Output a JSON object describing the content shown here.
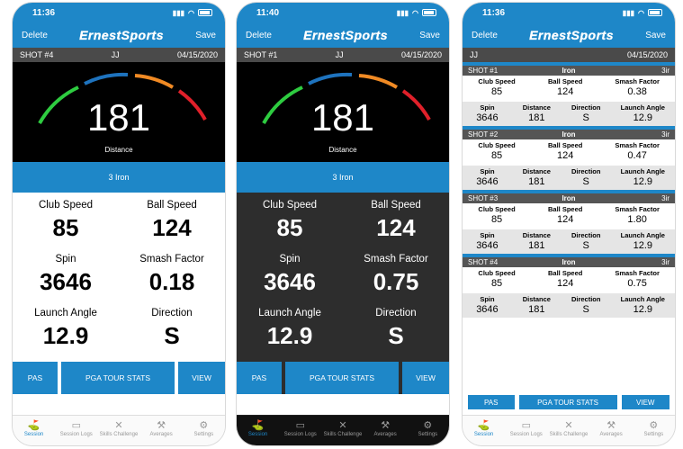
{
  "status": {
    "time1": "11:36",
    "time2": "11:40",
    "time3": "11:36"
  },
  "nav": {
    "left": "Delete",
    "brand": "ErnestSports",
    "right": "Save"
  },
  "screen1": {
    "shot": "SHOT #4",
    "player": "JJ",
    "date": "04/15/2020",
    "distance": "181",
    "distance_label": "Distance",
    "club": "3 Iron",
    "stats": [
      {
        "label": "Club Speed",
        "value": "85"
      },
      {
        "label": "Ball Speed",
        "value": "124"
      },
      {
        "label": "Spin",
        "value": "3646"
      },
      {
        "label": "Smash Factor",
        "value": "0.18"
      },
      {
        "label": "Launch Angle",
        "value": "12.9"
      },
      {
        "label": "Direction",
        "value": "S"
      }
    ]
  },
  "screen2": {
    "shot": "SHOT #1",
    "player": "JJ",
    "date": "04/15/2020",
    "distance": "181",
    "distance_label": "Distance",
    "club": "3 Iron",
    "stats": [
      {
        "label": "Club Speed",
        "value": "85"
      },
      {
        "label": "Ball Speed",
        "value": "124"
      },
      {
        "label": "Spin",
        "value": "3646"
      },
      {
        "label": "Smash Factor",
        "value": "0.75"
      },
      {
        "label": "Launch Angle",
        "value": "12.9"
      },
      {
        "label": "Direction",
        "value": "S"
      }
    ]
  },
  "buttons": {
    "pas": "PAS",
    "pga": "PGA TOUR STATS",
    "view": "VIEW"
  },
  "tabs": [
    "Session",
    "Session Logs",
    "Skills Challenge",
    "Averages",
    "Settings"
  ],
  "screen3": {
    "player": "JJ",
    "date": "04/15/2020",
    "labels": {
      "club_speed": "Club Speed",
      "ball_speed": "Ball Speed",
      "smash": "Smash Factor",
      "spin": "Spin",
      "distance": "Distance",
      "direction": "Direction",
      "launch": "Launch Angle"
    },
    "shots": [
      {
        "name": "SHOT #1",
        "club": "Iron",
        "code": "3ir",
        "club_speed": "85",
        "ball_speed": "124",
        "smash": "0.38",
        "spin": "3646",
        "distance": "181",
        "direction": "S",
        "launch": "12.9"
      },
      {
        "name": "SHOT #2",
        "club": "Iron",
        "code": "3ir",
        "club_speed": "85",
        "ball_speed": "124",
        "smash": "0.47",
        "spin": "3646",
        "distance": "181",
        "direction": "S",
        "launch": "12.9"
      },
      {
        "name": "SHOT #3",
        "club": "Iron",
        "code": "3ir",
        "club_speed": "85",
        "ball_speed": "124",
        "smash": "1.80",
        "spin": "3646",
        "distance": "181",
        "direction": "S",
        "launch": "12.9"
      },
      {
        "name": "SHOT #4",
        "club": "Iron",
        "code": "3ir",
        "club_speed": "85",
        "ball_speed": "124",
        "smash": "0.75",
        "spin": "3646",
        "distance": "181",
        "direction": "S",
        "launch": "12.9"
      }
    ]
  },
  "colors": {
    "accent": "#1e87c8",
    "gauge_green": "#2ecc40",
    "gauge_blue": "#1e73be",
    "gauge_orange": "#f08a24",
    "gauge_red": "#e0202a"
  }
}
